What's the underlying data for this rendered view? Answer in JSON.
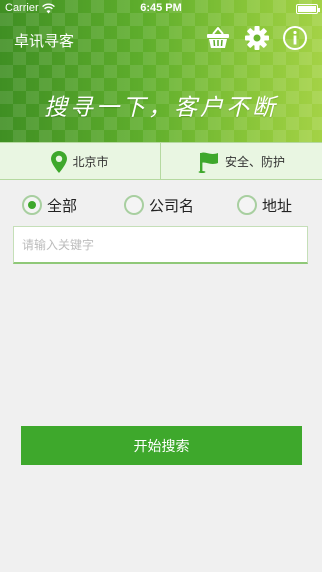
{
  "status_bar": {
    "carrier": "Carrier",
    "time": "6:45 PM"
  },
  "header": {
    "title": "卓讯寻客",
    "slogan": "搜寻一下，客户不断",
    "icons": [
      "basket-icon",
      "gear-icon",
      "info-icon"
    ]
  },
  "city_bar": {
    "city": "北京市",
    "category": "安全、防护"
  },
  "filter": {
    "options": [
      "全部",
      "公司名",
      "地址"
    ],
    "selected": "全部"
  },
  "search": {
    "placeholder": "请输入关键字",
    "value": "",
    "button_label": "开始搜索"
  },
  "colors": {
    "accent": "#3ea82c",
    "light_green_bg": "#e9f6e2",
    "page_bg": "#f0f0f0"
  }
}
